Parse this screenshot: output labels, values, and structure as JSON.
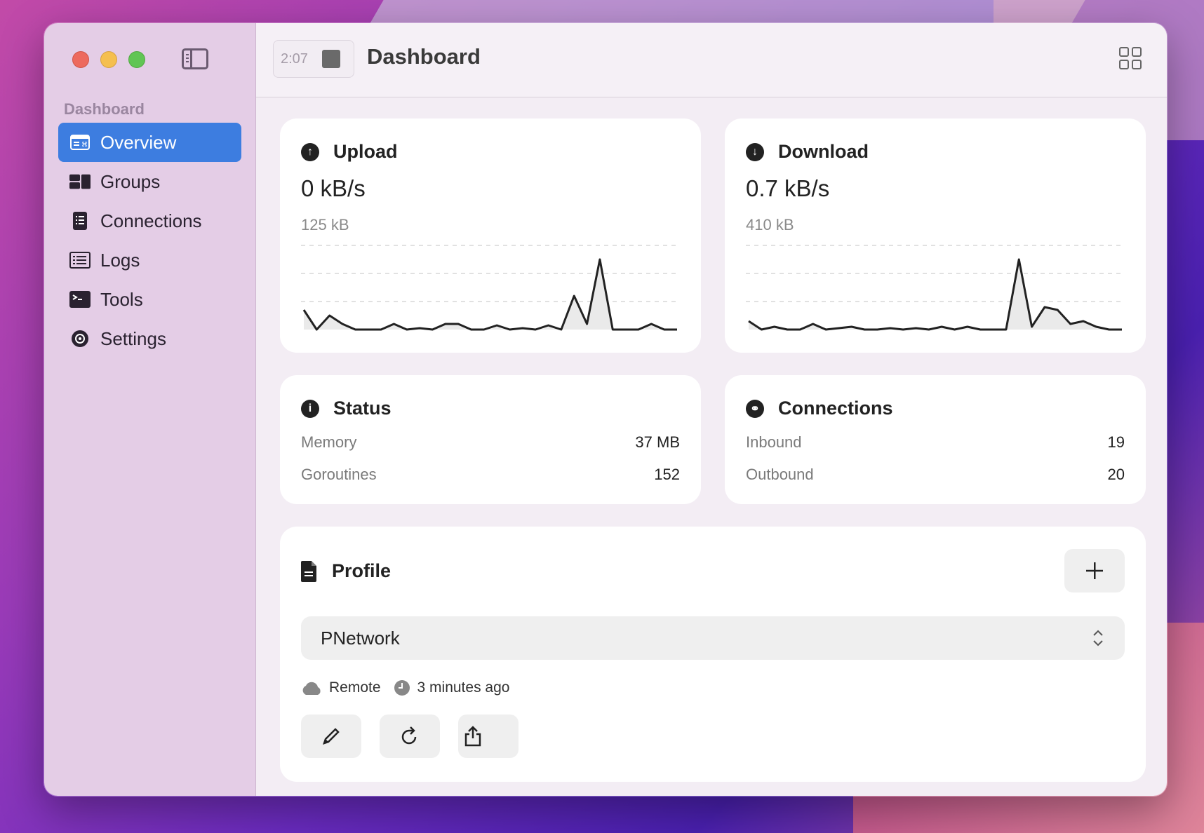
{
  "window": {
    "timer": "2:07",
    "title": "Dashboard"
  },
  "sidebar": {
    "section_label": "Dashboard",
    "items": [
      {
        "label": "Overview",
        "icon": "overview-icon",
        "active": true
      },
      {
        "label": "Groups",
        "icon": "groups-icon",
        "active": false
      },
      {
        "label": "Connections",
        "icon": "connections-list-icon",
        "active": false
      },
      {
        "label": "Logs",
        "icon": "logs-icon",
        "active": false
      },
      {
        "label": "Tools",
        "icon": "terminal-icon",
        "active": false
      },
      {
        "label": "Settings",
        "icon": "gear-icon",
        "active": false
      }
    ]
  },
  "upload": {
    "title": "Upload",
    "rate": "0 kB/s",
    "total": "125 kB"
  },
  "download": {
    "title": "Download",
    "rate": "0.7 kB/s",
    "total": "410 kB"
  },
  "status": {
    "title": "Status",
    "memory_label": "Memory",
    "memory_value": "37 MB",
    "goroutines_label": "Goroutines",
    "goroutines_value": "152"
  },
  "connections": {
    "title": "Connections",
    "inbound_label": "Inbound",
    "inbound_value": "19",
    "outbound_label": "Outbound",
    "outbound_value": "20"
  },
  "profile": {
    "title": "Profile",
    "selected": "PNetwork",
    "type": "Remote",
    "updated": "3 minutes ago"
  },
  "chart_data": [
    {
      "type": "area",
      "ylim": [
        0,
        3
      ],
      "grid": true,
      "values": [
        0.7,
        0,
        0.5,
        0.2,
        0,
        0,
        0,
        0.2,
        0,
        0.05,
        0,
        0.2,
        0.2,
        0,
        0,
        0.15,
        0,
        0.05,
        0,
        0.15,
        0,
        1.2,
        0.2,
        2.5,
        0,
        0,
        0,
        0.2,
        0,
        0
      ]
    },
    {
      "type": "area",
      "ylim": [
        0,
        3
      ],
      "grid": true,
      "values": [
        0.3,
        0,
        0.1,
        0,
        0,
        0.2,
        0,
        0.05,
        0.1,
        0,
        0,
        0.05,
        0,
        0.05,
        0,
        0.1,
        0,
        0.1,
        0,
        0,
        0,
        2.5,
        0.1,
        0.8,
        0.7,
        0.2,
        0.3,
        0.1,
        0,
        0
      ]
    }
  ],
  "colors": {
    "accent": "#3d7de0",
    "sidebar_bg": "#e4cde6",
    "main_bg": "#f3edf4"
  }
}
